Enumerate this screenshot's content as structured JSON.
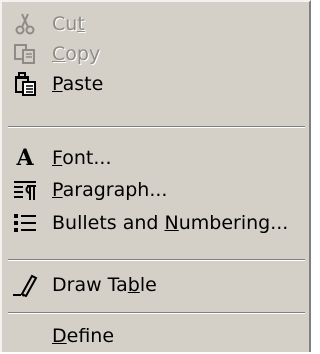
{
  "menu": {
    "items": [
      {
        "label": "Cut",
        "accel": "t",
        "pre": "Cu",
        "post": "",
        "enabled": false,
        "icon": "scissors-icon"
      },
      {
        "label": "Copy",
        "accel": "C",
        "pre": "",
        "post": "opy",
        "enabled": false,
        "icon": "copy-icon"
      },
      {
        "label": "Paste",
        "accel": "P",
        "pre": "",
        "post": "aste",
        "enabled": true,
        "icon": "paste-icon"
      },
      {
        "label": "Font...",
        "accel": "F",
        "pre": "",
        "post": "ont...",
        "enabled": true,
        "icon": "font-icon"
      },
      {
        "label": "Paragraph...",
        "accel": "P",
        "pre": "",
        "post": "aragraph...",
        "enabled": true,
        "icon": "paragraph-icon"
      },
      {
        "label": "Bullets and Numbering...",
        "accel": "N",
        "pre": "Bullets and ",
        "post": "umbering...",
        "enabled": true,
        "icon": "bullets-icon"
      },
      {
        "label": "Draw Table",
        "accel": "b",
        "pre": "Draw Ta",
        "post": "le",
        "enabled": true,
        "icon": "draw-table-icon"
      },
      {
        "label": "Define",
        "accel": "D",
        "pre": "",
        "post": "efine",
        "enabled": true,
        "icon": ""
      }
    ]
  }
}
